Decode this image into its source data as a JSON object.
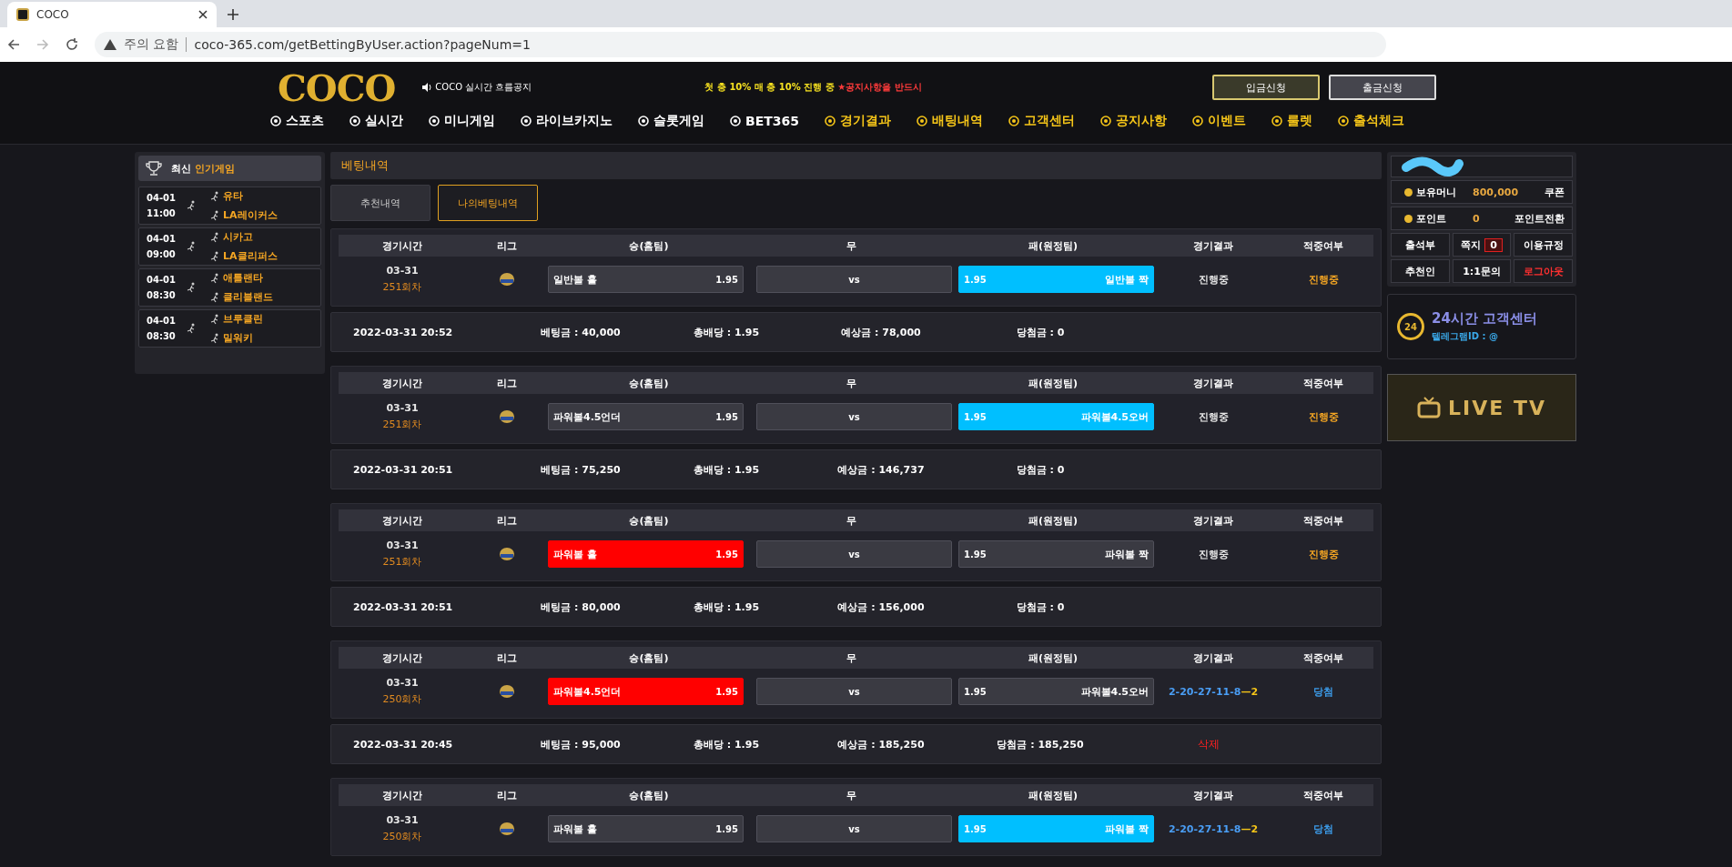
{
  "browser": {
    "tab_title": "COCO",
    "security": "주의 요함",
    "url": "coco-365.com/getBettingByUser.action?pageNum=1"
  },
  "header": {
    "logo": "COCO",
    "notice_label": "COCO 실시간 흐름공지",
    "marquee": "첫 충 10% 매 충 10% 진행 중",
    "marquee_alert": "★공지사항을 반드시",
    "buttons": [
      {
        "label": "입금신청",
        "kind": "deposit"
      },
      {
        "label": "출금신청",
        "kind": "withdraw"
      }
    ]
  },
  "nav": [
    {
      "label": "스포츠",
      "color": "#ffffff"
    },
    {
      "label": "실시간",
      "color": "#ffffff"
    },
    {
      "label": "미니게임",
      "color": "#ffffff"
    },
    {
      "label": "라이브카지노",
      "color": "#ffffff"
    },
    {
      "label": "슬롯게임",
      "color": "#ffffff"
    },
    {
      "label": "BET365",
      "color": "#ffffff"
    },
    {
      "label": "경기결과",
      "color": "#f5c518"
    },
    {
      "label": "배팅내역",
      "color": "#f5c518"
    },
    {
      "label": "고객센터",
      "color": "#f5c518"
    },
    {
      "label": "공지사항",
      "color": "#f5c518"
    },
    {
      "label": "이벤트",
      "color": "#f5c518"
    },
    {
      "label": "룰렛",
      "color": "#f5c518"
    },
    {
      "label": "출석체크",
      "color": "#f5c518"
    }
  ],
  "sidebar_left": {
    "title": "최신",
    "title_accent": "인기게임",
    "games": [
      {
        "date": "04-01",
        "time": "11:00",
        "home": "유타",
        "away": "LA레이커스"
      },
      {
        "date": "04-01",
        "time": "09:00",
        "home": "시카고",
        "away": "LA클리퍼스"
      },
      {
        "date": "04-01",
        "time": "08:30",
        "home": "애틀랜타",
        "away": "클리블랜드"
      },
      {
        "date": "04-01",
        "time": "08:30",
        "home": "브루클린",
        "away": "밀워키"
      }
    ]
  },
  "panel": {
    "title": "베팅내역",
    "tabs": [
      {
        "label": "추천내역",
        "selected": false
      },
      {
        "label": "나의베팅내역",
        "selected": true
      }
    ],
    "bets": [
      {
        "columns": [
          "경기시간",
          "리그",
          "승(홈팀)",
          "무",
          "패(원정팀)",
          "경기결과",
          "적중여부"
        ],
        "date": "03-31",
        "round": "251회차",
        "options": [
          {
            "label": "일반볼 홀",
            "odds": "1.95",
            "selected": false
          },
          {
            "label": "vs",
            "selected": false
          },
          {
            "label": "일반볼 짝",
            "odds": "1.95",
            "selected": true
          }
        ],
        "result": {
          "text": "진행중",
          "color": "#e6e6e6"
        },
        "hit": {
          "text": "진행중",
          "color": "#f5a623"
        },
        "summary": {
          "placed_at": "2022-03-31 20:52",
          "stake": "베팅금 : 40,000",
          "odds": "총배당 : 1.95",
          "expected": "예상금 : 78,000",
          "payout": "당첨금 : 0"
        }
      },
      {
        "columns": [
          "경기시간",
          "리그",
          "승(홈팀)",
          "무",
          "패(원정팀)",
          "경기결과",
          "적중여부"
        ],
        "date": "03-31",
        "round": "251회차",
        "options": [
          {
            "label": "파워볼4.5언더",
            "odds": "1.95",
            "selected": false
          },
          {
            "label": "vs",
            "selected": false
          },
          {
            "label": "파워볼4.5오버",
            "odds": "1.95",
            "selected": true
          }
        ],
        "result": {
          "text": "진행중",
          "color": "#e6e6e6"
        },
        "hit": {
          "text": "진행중",
          "color": "#f5a623"
        },
        "summary": {
          "placed_at": "2022-03-31 20:51",
          "stake": "베팅금 : 75,250",
          "odds": "총배당 : 1.95",
          "expected": "예상금 : 146,737",
          "payout": "당첨금 : 0"
        }
      },
      {
        "columns": [
          "경기시간",
          "리그",
          "승(홈팀)",
          "무",
          "패(원정팀)",
          "경기결과",
          "적중여부"
        ],
        "date": "03-31",
        "round": "251회차",
        "options": [
          {
            "label": "파워볼 홀",
            "odds": "1.95",
            "selected": true
          },
          {
            "label": "vs",
            "selected": false
          },
          {
            "label": "파워볼 짝",
            "odds": "1.95",
            "selected": false
          }
        ],
        "result": {
          "text": "진행중",
          "color": "#e6e6e6"
        },
        "hit": {
          "text": "진행중",
          "color": "#f5a623"
        },
        "summary": {
          "placed_at": "2022-03-31 20:51",
          "stake": "베팅금 : 80,000",
          "odds": "총배당 : 1.95",
          "expected": "예상금 : 156,000",
          "payout": "당첨금 : 0"
        }
      },
      {
        "columns": [
          "경기시간",
          "리그",
          "승(홈팀)",
          "무",
          "패(원정팀)",
          "경기결과",
          "적중여부"
        ],
        "date": "03-31",
        "round": "250회차",
        "options": [
          {
            "label": "파워볼4.5언더",
            "odds": "1.95",
            "selected": true
          },
          {
            "label": "vs",
            "selected": false
          },
          {
            "label": "파워볼4.5오버",
            "odds": "1.95",
            "selected": false
          }
        ],
        "result": {
          "text": "2-20-27-11-8",
          "extra": "—2",
          "color": "#4a9ef5"
        },
        "hit": {
          "text": "당첨",
          "color": "#3c9be8"
        },
        "summary": {
          "placed_at": "2022-03-31 20:45",
          "stake": "베팅금 : 95,000",
          "odds": "총배당 : 1.95",
          "expected": "예상금 : 185,250",
          "payout": "당첨금 : 185,250",
          "action": "삭제"
        }
      },
      {
        "columns": [
          "경기시간",
          "리그",
          "승(홈팀)",
          "무",
          "패(원정팀)",
          "경기결과",
          "적중여부"
        ],
        "date": "03-31",
        "round": "250회차",
        "options": [
          {
            "label": "파워볼 홀",
            "odds": "1.95",
            "selected": false
          },
          {
            "label": "vs",
            "selected": false
          },
          {
            "label": "파워볼 짝",
            "odds": "1.95",
            "selected": true
          }
        ],
        "result": {
          "text": "2-20-27-11-8",
          "extra": "—2",
          "color": "#4a9ef5"
        },
        "hit": {
          "text": "당첨",
          "color": "#3c9be8"
        }
      }
    ]
  },
  "account": {
    "balance_label": "보유머니",
    "balance": "800,000",
    "coupon": "쿠폰",
    "points_label": "포인트",
    "points": "0",
    "points_action": "포인트전환",
    "links": [
      {
        "label": "출석부",
        "kind": "link"
      },
      {
        "label": "쪽지",
        "kind": "message",
        "badge": "0"
      },
      {
        "label": "이용규정",
        "kind": "link"
      },
      {
        "label": "추천인",
        "kind": "link"
      },
      {
        "label": "1:1문의",
        "kind": "link"
      },
      {
        "label": "로그아웃",
        "kind": "logout"
      }
    ]
  },
  "support": {
    "title": "24시간 고객센터",
    "telegram": "텔레그램ID : @",
    "badge": "24"
  },
  "live_tv": {
    "label": "LIVE TV"
  }
}
